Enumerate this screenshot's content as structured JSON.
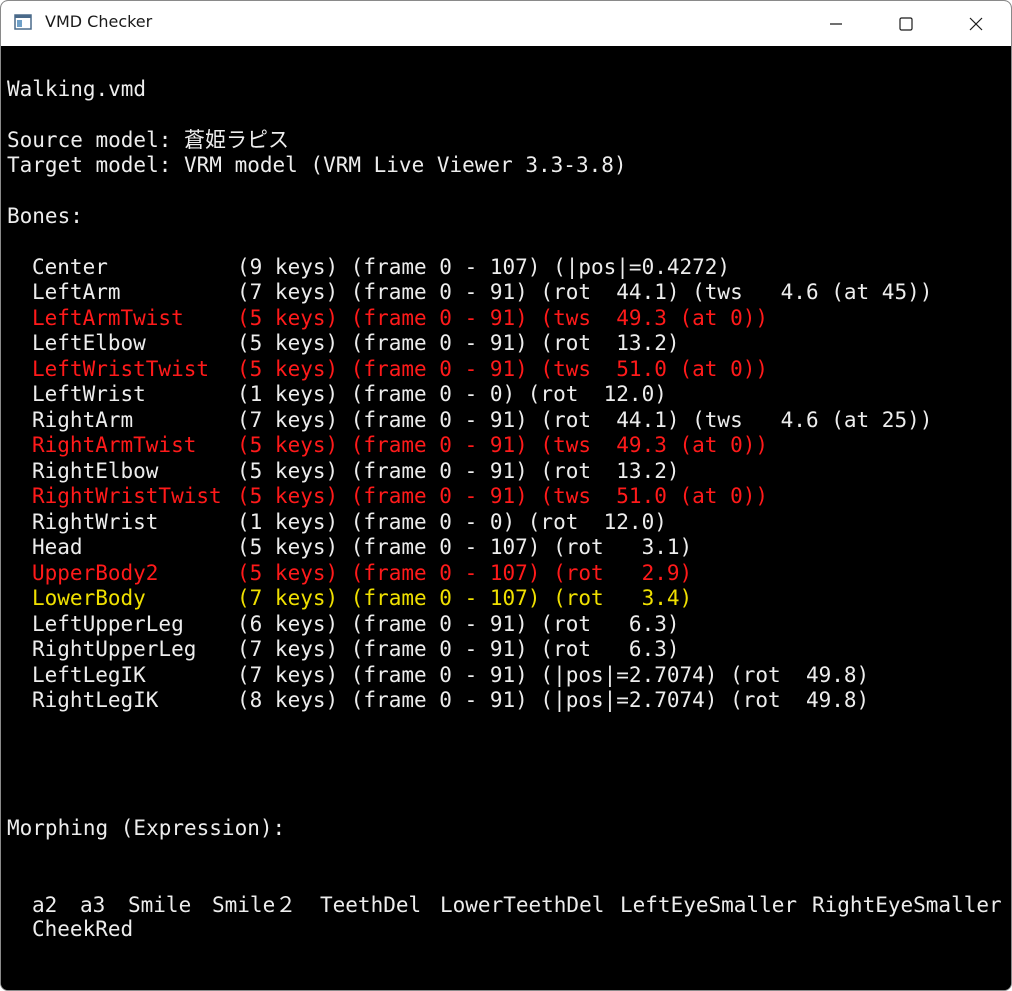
{
  "window": {
    "title": "VMD Checker"
  },
  "colors": {
    "background": "#000000",
    "text": "#ededed",
    "warning_red": "#ff1a1a",
    "warning_yellow": "#f0e000"
  },
  "console": {
    "file": "Walking.vmd",
    "source_model": "Source model: 蒼姫ラピス",
    "target_model": "Target model: VRM model (VRM Live Viewer 3.3-3.8)",
    "bones_header": "Bones:",
    "bones": [
      {
        "name": "Center",
        "info": "(9 keys) (frame 0 - 107) (|pos|=0.4272)",
        "color": "normal"
      },
      {
        "name": "LeftArm",
        "info": "(7 keys) (frame 0 - 91) (rot  44.1) (tws   4.6 (at 45))",
        "color": "normal"
      },
      {
        "name": "LeftArmTwist",
        "info": "(5 keys) (frame 0 - 91) (tws  49.3 (at 0))",
        "color": "red"
      },
      {
        "name": "LeftElbow",
        "info": "(5 keys) (frame 0 - 91) (rot  13.2)",
        "color": "normal"
      },
      {
        "name": "LeftWristTwist",
        "info": "(5 keys) (frame 0 - 91) (tws  51.0 (at 0))",
        "color": "red"
      },
      {
        "name": "LeftWrist",
        "info": "(1 keys) (frame 0 - 0) (rot  12.0)",
        "color": "normal"
      },
      {
        "name": "RightArm",
        "info": "(7 keys) (frame 0 - 91) (rot  44.1) (tws   4.6 (at 25))",
        "color": "normal"
      },
      {
        "name": "RightArmTwist",
        "info": "(5 keys) (frame 0 - 91) (tws  49.3 (at 0))",
        "color": "red"
      },
      {
        "name": "RightElbow",
        "info": "(5 keys) (frame 0 - 91) (rot  13.2)",
        "color": "normal"
      },
      {
        "name": "RightWristTwist",
        "info": "(5 keys) (frame 0 - 91) (tws  51.0 (at 0))",
        "color": "red"
      },
      {
        "name": "RightWrist",
        "info": "(1 keys) (frame 0 - 0) (rot  12.0)",
        "color": "normal"
      },
      {
        "name": "Head",
        "info": "(5 keys) (frame 0 - 107) (rot   3.1)",
        "color": "normal"
      },
      {
        "name": "UpperBody2",
        "info": "(5 keys) (frame 0 - 107) (rot   2.9)",
        "color": "red"
      },
      {
        "name": "LowerBody",
        "info": "(7 keys) (frame 0 - 107) (rot   3.4)",
        "color": "yellow"
      },
      {
        "name": "LeftUpperLeg",
        "info": "(6 keys) (frame 0 - 91) (rot   6.3)",
        "color": "normal"
      },
      {
        "name": "RightUpperLeg",
        "info": "(7 keys) (frame 0 - 91) (rot   6.3)",
        "color": "normal"
      },
      {
        "name": "LeftLegIK",
        "info": "(7 keys) (frame 0 - 91) (|pos|=2.7074) (rot  49.8)",
        "color": "normal"
      },
      {
        "name": "RightLegIK",
        "info": "(8 keys) (frame 0 - 91) (|pos|=2.7074) (rot  49.8)",
        "color": "normal"
      }
    ],
    "morph_header": "Morphing (Expression):",
    "morphs": [
      "a2",
      "a3",
      "Smile",
      "Smile２",
      "TeethDel",
      "LowerTeethDel",
      "LeftEyeSmaller",
      "RightEyeSmaller",
      "CheekRed"
    ]
  }
}
